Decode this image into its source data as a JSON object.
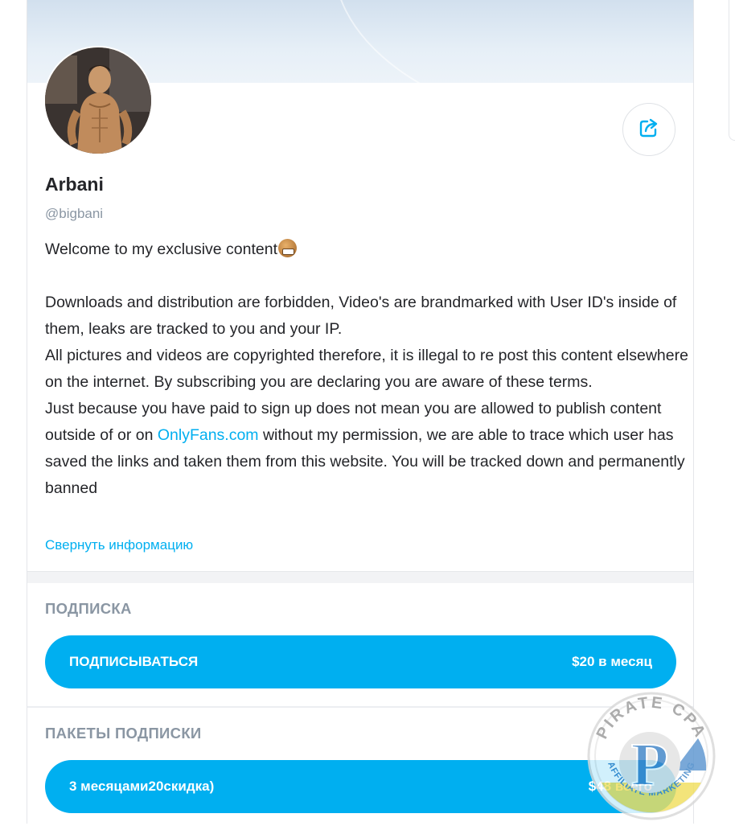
{
  "profile": {
    "name": "Arbani",
    "handle": "@bigbani"
  },
  "bio": {
    "line1": "Welcome to my exclusive content",
    "para_a": "Downloads and distribution are forbidden, Video's are brandmarked with User ID's inside of them, leaks are tracked to you and your IP.",
    "para_b": "All pictures and videos are copyrighted therefore, it is illegal to re post this content elsewhere on the internet. By subscribing you are declaring you are aware of these terms.",
    "para_c_before": "Just because you have paid to sign up does not mean you are allowed to publish content outside of or on ",
    "para_c_link": "OnlyFans.com",
    "para_c_after": " without my permission, we are able to trace which user has saved the links and taken them from this website. You will be tracked down and permanently banned",
    "collapse_label": "Свернуть информацию"
  },
  "subscription": {
    "title": "ПОДПИСКА",
    "button_label": "ПОДПИСЫВАТЬСЯ",
    "price": "$20 в месяц"
  },
  "bundles": {
    "title": "ПАКЕТЫ ПОДПИСКИ",
    "items": [
      {
        "label": "3 месяцами20скидка)",
        "price": "$48 всего"
      }
    ]
  },
  "watermark": {
    "text_top": "PIRATE CPA",
    "text_bottom": "AFFILIATE MARKETING",
    "letter": "P"
  },
  "icons": {
    "share": "share-icon"
  },
  "colors": {
    "accent": "#00aff0",
    "muted": "#8a96a3",
    "text": "#242529"
  }
}
